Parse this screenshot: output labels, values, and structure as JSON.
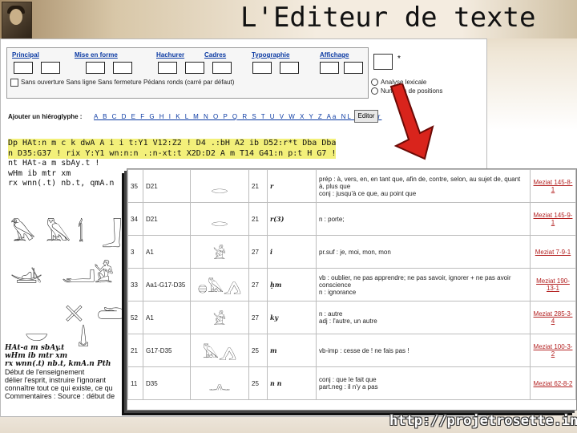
{
  "slide": {
    "title": "L'Editeur de texte",
    "footer_url": "http://projetrosette.info"
  },
  "editor": {
    "menus": [
      "Principal",
      "Mise en forme",
      "Hachurer",
      "Cadres",
      "Typographie",
      "Affichage"
    ],
    "options_line": "Sans ouverture     Sans ligne     Sans fermeture     Pédans ronds     (carré par défaut)",
    "side_value": "*",
    "radio_options": [
      "Analyse lexicale",
      "Numéros de positions"
    ],
    "add_hieroglyph_label": "Ajouter un hiéroglyphe :",
    "alphabet": "A B C D E F G H I K L M N O P Q R S T U V W X Y Z Aa NL NU Gr",
    "editor_button": "Editor",
    "transliteration_lines": [
      "Dp HAt:n m c k dwA A i i t:Y1 V12:Z2 ! D4 .:bH A2 ib D52:r*t Dba Dba",
      "n D35:G37 ! rix Y:Y1 wn:n:n .:n-xt:t X2D:D2 A m T14 G41:n p:t H G7 !",
      "nt HAt-a m sbAy.t !",
      "wHm ib mtr xm",
      "rx wnn(.t) nb.t, qmA.n"
    ],
    "notes": [
      "HAt-a m sbAy.t",
      "wHm ib mtr xm",
      "rx wnn(.t) nb.t, kmA.n Pth",
      "Début de l'enseignement",
      "délier l'esprit, instruire l'ignorant",
      "connaître tout ce qui existe, ce qu",
      "Commentaires : Source : début de"
    ],
    "glyph_icons": [
      "falcon-icon",
      "owl-icon",
      "cane-icon",
      "leg-icon",
      "quail-icon",
      "boat-icon",
      "arm-icon",
      "seated-man-icon",
      "arrows-icon",
      "basket-icon",
      "scales-icon",
      "hand-icon"
    ]
  },
  "dictionary": {
    "rows": [
      {
        "num": "35",
        "code": "D21",
        "glyph": "mouth-icon",
        "count": "21",
        "translit": "r",
        "definition": "prép : à, vers, en, en tant que, afin de, contre, selon, au sujet de, quant à, plus que\nconj : jusqu'à ce que, au point que",
        "ref": "Meziat 145-8-1"
      },
      {
        "num": "34",
        "code": "D21",
        "glyph": "mouth-icon",
        "count": "21",
        "translit": "r(3)",
        "definition": "n : porte;",
        "ref": "Meziat 145-9-1"
      },
      {
        "num": "3",
        "code": "A1",
        "glyph": "seated-man-icon",
        "count": "27",
        "translit": "i",
        "definition": "pr.suf : je, moi, mon, mon",
        "ref": "Meziat 7-9-1"
      },
      {
        "num": "33",
        "code": "Aa1-G17-D35",
        "glyph": "hieroglyph-group-icon",
        "count": "27",
        "translit": "ḫm",
        "definition": "vb : oublier, ne pas apprendre; ne pas savoir, ignorer + ne pas avoir conscience\nn : ignorance",
        "ref": "Meziat 190-13-1"
      },
      {
        "num": "52",
        "code": "A1",
        "glyph": "seated-man-icon",
        "count": "27",
        "translit": "ky",
        "definition": "n : autre\nadj : l'autre, un autre",
        "ref": "Meziat 285-3-4"
      },
      {
        "num": "21",
        "code": "G17-D35",
        "glyph": "owl-arm-icon",
        "count": "25",
        "translit": "m",
        "definition": "vb-imp : cesse de ! ne fais pas !",
        "ref": "Meziat 100-3-2"
      },
      {
        "num": "11",
        "code": "D35",
        "glyph": "arms-icon",
        "count": "25",
        "translit": "n n",
        "definition": "conj : que le fait que\npart.neg : il n'y a pas",
        "ref": "Meziat 62-8-2"
      }
    ]
  },
  "colors": {
    "link_blue": "#0b3aa3",
    "ref_red": "#b32020",
    "arrow_red": "#d9241c",
    "highlight": "#f3f07a"
  }
}
